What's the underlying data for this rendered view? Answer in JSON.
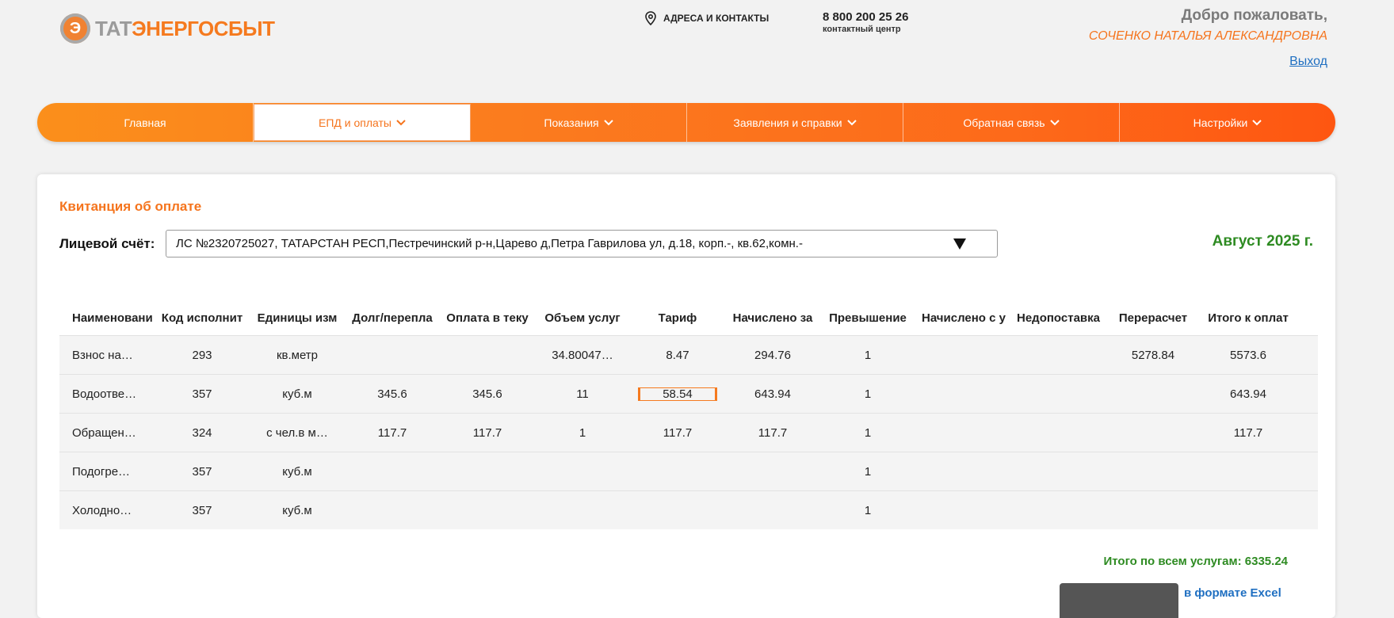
{
  "header": {
    "logo_part1": "ТАТ",
    "logo_part2": "ЭНЕРГОСБЫТ",
    "addresses_label": "АДРЕСА И КОНТАКТЫ",
    "phone": "8 800 200 25 26",
    "phone_caption": "контактный центр",
    "welcome": "Добро пожаловать,",
    "user_name": "СОЧЕНКО НАТАЛЬЯ АЛЕКСАНДРОВНА",
    "logout": "Выход"
  },
  "nav": {
    "items": [
      {
        "label": "Главная"
      },
      {
        "label": "ЕПД и оплаты"
      },
      {
        "label": "Показания"
      },
      {
        "label": "Заявления и справки"
      },
      {
        "label": "Обратная связь"
      },
      {
        "label": "Настройки"
      }
    ]
  },
  "receipt": {
    "title": "Квитанция об оплате",
    "account_label": "Лицевой счёт:",
    "account_value": "ЛС №2320725027, ТАТАРСТАН РЕСП,Пестречинский р-н,Царево д,Петра Гаврилова ул, д.18, корп.-, кв.62,комн.-",
    "period": "Август 2025 г.",
    "columns": [
      "Наименовани",
      "Код исполнит",
      "Единицы изм",
      "Долг/перепла",
      "Оплата в теку",
      "Объем услуг",
      "Тариф",
      "Начислено за",
      "Превышение",
      "Начислено с у",
      "Недопоставка",
      "Перерасчет",
      "Итого к оплат"
    ],
    "rows": [
      [
        "Взнос на…",
        "293",
        "кв.метр",
        "",
        "",
        "34.80047…",
        "8.47",
        "294.76",
        "1",
        "",
        "",
        "5278.84",
        "5573.6"
      ],
      [
        "Водоотве…",
        "357",
        "куб.м",
        "345.6",
        "345.6",
        "11",
        "58.54",
        "643.94",
        "1",
        "",
        "",
        "",
        "643.94"
      ],
      [
        "Обращен…",
        "324",
        "с чел.в м…",
        "117.7",
        "117.7",
        "1",
        "117.7",
        "117.7",
        "1",
        "",
        "",
        "",
        "117.7"
      ],
      [
        "Подогре…",
        "357",
        "куб.м",
        "",
        "",
        "",
        "",
        "",
        "1",
        "",
        "",
        "",
        ""
      ],
      [
        "Холодно…",
        "357",
        "куб.м",
        "",
        "",
        "",
        "",
        "",
        "1",
        "",
        "",
        "",
        ""
      ]
    ],
    "total": "Итого по всем услугам: 6335.24",
    "excel_link": "в формате Excel"
  },
  "colors": {
    "accent": "#f5741d",
    "green": "#2e8b22",
    "link": "#1f6fc1"
  },
  "icons": {
    "location": "map-pin-icon",
    "chevron": "chevron-down-icon",
    "dropdown": "triangle-down-icon"
  }
}
